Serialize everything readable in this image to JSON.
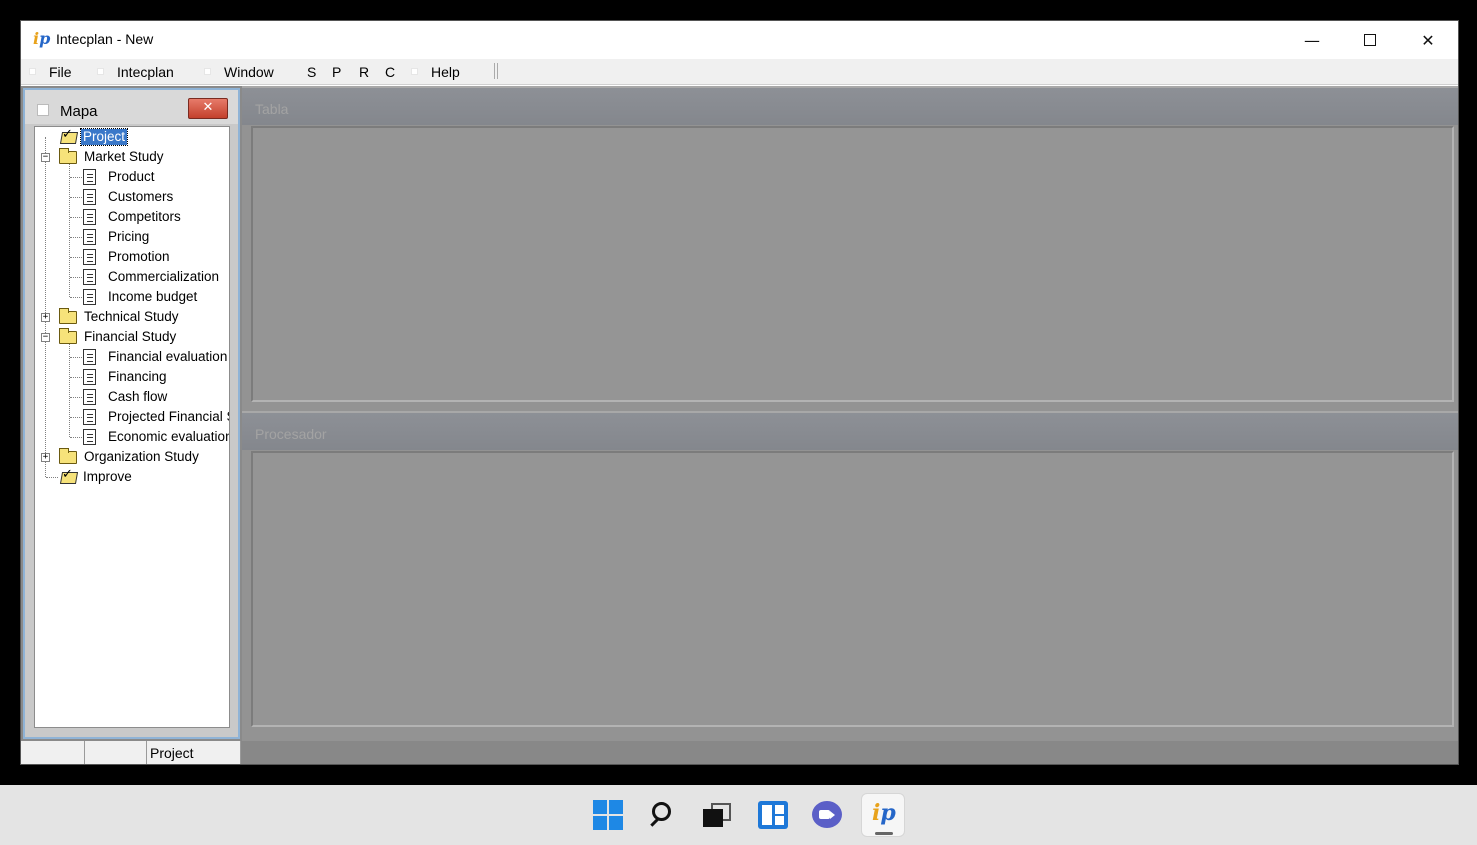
{
  "window": {
    "title": "Intecplan - New",
    "logo_text_i": "i",
    "logo_text_p": "p",
    "minimize_glyph": "—",
    "close_glyph": "✕"
  },
  "menu": {
    "items": [
      "File",
      "Intecplan",
      "Window",
      "S",
      "P",
      "R",
      "C",
      "Help"
    ]
  },
  "left_panel": {
    "title": "Mapa",
    "close_glyph": "✕",
    "tree": [
      {
        "label": "Project",
        "type": "project",
        "level": 0,
        "selected": true
      },
      {
        "label": "Market Study",
        "type": "folder",
        "level": 0,
        "expander": "−"
      },
      {
        "label": "Product",
        "type": "doc",
        "level": 1
      },
      {
        "label": "Customers",
        "type": "doc",
        "level": 1
      },
      {
        "label": "Competitors",
        "type": "doc",
        "level": 1
      },
      {
        "label": "Pricing",
        "type": "doc",
        "level": 1
      },
      {
        "label": "Promotion",
        "type": "doc",
        "level": 1
      },
      {
        "label": "Commercialization",
        "type": "doc",
        "level": 1
      },
      {
        "label": "Income budget",
        "type": "doc",
        "level": 1
      },
      {
        "label": "Technical Study",
        "type": "folder",
        "level": 0,
        "expander": "+"
      },
      {
        "label": "Financial Study",
        "type": "folder",
        "level": 0,
        "expander": "−"
      },
      {
        "label": "Financial evaluation",
        "type": "doc",
        "level": 1
      },
      {
        "label": "Financing",
        "type": "doc",
        "level": 1
      },
      {
        "label": "Cash flow",
        "type": "doc",
        "level": 1
      },
      {
        "label": "Projected Financial S",
        "type": "doc",
        "level": 1
      },
      {
        "label": "Economic evaluation",
        "type": "doc",
        "level": 1
      },
      {
        "label": "Organization Study",
        "type": "folder",
        "level": 0,
        "expander": "+"
      },
      {
        "label": "Improve",
        "type": "project",
        "level": 0
      }
    ]
  },
  "mdi": {
    "tabla_title": "Tabla",
    "procesador_title": "Procesador"
  },
  "statusbar": {
    "cells": [
      "",
      "",
      "Project"
    ]
  },
  "colors": {
    "accent": "#3a78c9",
    "mdi_background": "#8a8a8a",
    "close_button": "#c3402c"
  },
  "taskbar": {
    "icons": [
      "windows-start-icon",
      "search-icon",
      "task-view-icon",
      "widgets-icon",
      "chat-icon",
      "intecplan-app-icon"
    ]
  }
}
